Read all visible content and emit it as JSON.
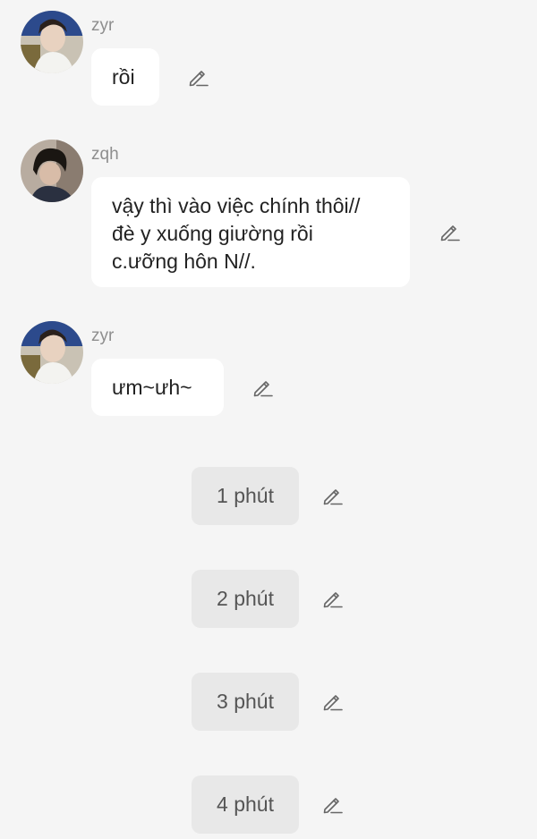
{
  "messages": [
    {
      "sender": "zyr",
      "lines": [
        "rồi"
      ]
    },
    {
      "sender": "zqh",
      "lines": [
        "vậy thì vào việc chính thôi//",
        "đè y xuống giường rồi",
        "c.ưỡng hôn N//."
      ]
    },
    {
      "sender": "zyr",
      "lines": [
        "ưm~ưh~"
      ]
    }
  ],
  "time_chips": [
    "1 phút",
    "2 phút",
    "3 phút",
    "4 phút"
  ],
  "icons": {
    "edit": "pencil-edit-icon",
    "avatar": "profile-photo"
  },
  "colors": {
    "background": "#f5f5f5",
    "bubble": "#ffffff",
    "chip": "#e8e8e8",
    "name": "#8e8e8e"
  }
}
